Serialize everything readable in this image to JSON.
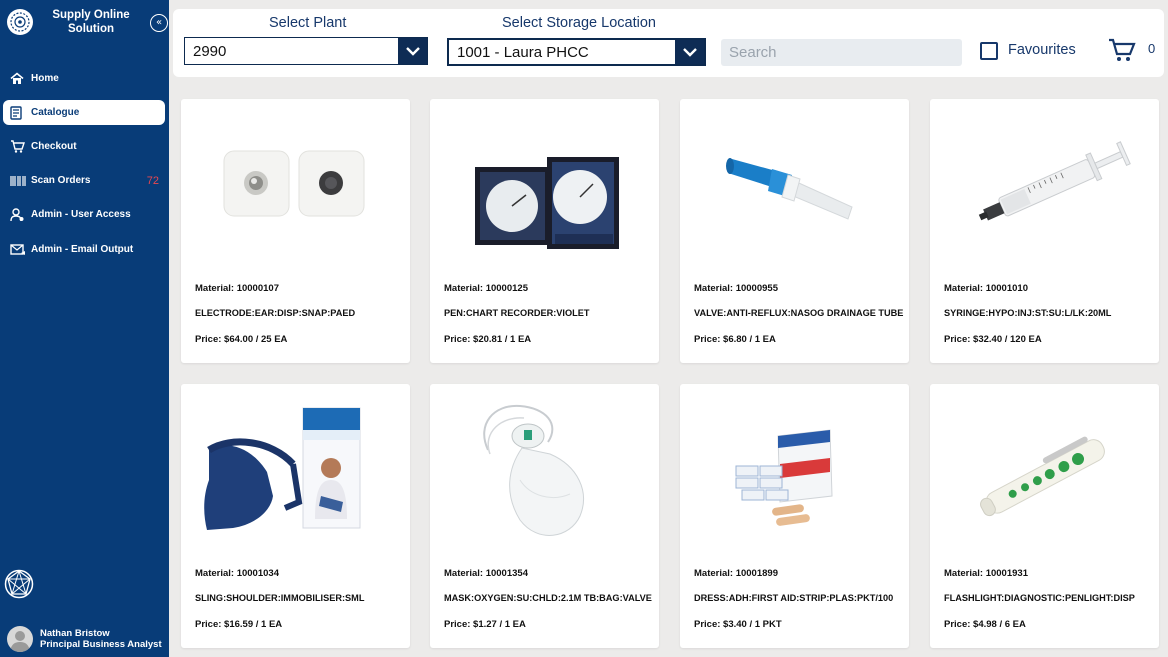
{
  "app": {
    "title": "Supply Online Solution",
    "collapse_icon": "«"
  },
  "nav": [
    {
      "label": "Home",
      "icon": "home-icon"
    },
    {
      "label": "Catalogue",
      "icon": "catalogue-icon",
      "active": true
    },
    {
      "label": "Checkout",
      "icon": "cart-icon"
    },
    {
      "label": "Scan Orders",
      "icon": "barcode-icon",
      "badge": "72"
    },
    {
      "label": "Admin - User Access",
      "icon": "user-icon"
    },
    {
      "label": "Admin - Email Output",
      "icon": "email-icon"
    }
  ],
  "user": {
    "name": "Nathan Bristow",
    "role": "Principal Business Analyst"
  },
  "filters": {
    "plant_label": "Select Plant",
    "plant_value": "2990",
    "location_label": "Select Storage Location",
    "location_value": "1001 - Laura PHCC",
    "search_placeholder": "Search",
    "favourites_label": "Favourites",
    "cart_count": "0"
  },
  "products": [
    {
      "material": "Material: 10000107",
      "desc": "ELECTRODE:EAR:DISP:SNAP:PAED",
      "price": "Price: $64.00 / 25 EA",
      "image": "electrode"
    },
    {
      "material": "Material: 10000125",
      "desc": "PEN:CHART RECORDER:VIOLET",
      "price": "Price: $20.81 / 1 EA",
      "image": "chart-recorder"
    },
    {
      "material": "Material: 10000955",
      "desc": "VALVE:ANTI-REFLUX:NASOG DRAINAGE TUBE",
      "price": "Price: $6.80 / 1 EA",
      "image": "valve"
    },
    {
      "material": "Material: 10001010",
      "desc": "SYRINGE:HYPO:INJ:ST:SU:L/LK:20ML",
      "price": "Price: $32.40 / 120 EA",
      "image": "syringe"
    },
    {
      "material": "Material: 10001034",
      "desc": "SLING:SHOULDER:IMMOBILISER:SML",
      "price": "Price: $16.59 / 1 EA",
      "image": "sling"
    },
    {
      "material": "Material: 10001354",
      "desc": "MASK:OXYGEN:SU:CHLD:2.1M TB:BAG:VALVE",
      "price": "Price: $1.27 / 1 EA",
      "image": "oxygen-mask"
    },
    {
      "material": "Material: 10001899",
      "desc": "DRESS:ADH:FIRST AID:STRIP:PLAS:PKT/100",
      "price": "Price: $3.40 / 1 PKT",
      "image": "first-aid"
    },
    {
      "material": "Material: 10001931",
      "desc": "FLASHLIGHT:DIAGNOSTIC:PENLIGHT:DISP",
      "price": "Price: $4.98 / 6 EA",
      "image": "penlight"
    }
  ],
  "colors": {
    "sidebar": "#083c78",
    "accent": "#17386b",
    "badge": "#e8474f"
  }
}
